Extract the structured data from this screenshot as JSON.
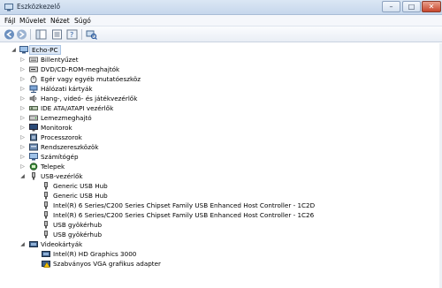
{
  "window": {
    "title": "Eszközkezelő"
  },
  "menu": {
    "items": [
      "Fájl",
      "Művelet",
      "Nézet",
      "Súgó"
    ]
  },
  "tree": {
    "root": "Echo-PC",
    "categories": [
      "Billentyűzet",
      "DVD/CD-ROM-meghajtók",
      "Egér vagy egyéb mutatóeszköz",
      "Hálózati kártyák",
      "Hang-, videó- és játékvezérlők",
      "IDE ATA/ATAPI vezérlők",
      "Lemezmeghajtó",
      "Monitorok",
      "Processzorok",
      "Rendszereszközök",
      "Számítógép",
      "Telepek",
      "USB-vezérlők"
    ],
    "usb_children": [
      "Generic USB Hub",
      "Generic USB Hub",
      "Intel(R) 6 Series/C200 Series Chipset Family USB Enhanced Host Controller - 1C2D",
      "Intel(R) 6 Series/C200 Series Chipset Family USB Enhanced Host Controller - 1C26",
      "USB gyökérhub",
      "USB gyökérhub"
    ],
    "video_category": "Videokártyák",
    "video_children": [
      "Intel(R) HD Graphics 3000",
      "Szabványos VGA grafikus adapter"
    ]
  },
  "colors": {
    "accent": "#3a6ea5",
    "warning": "#f2c200"
  }
}
